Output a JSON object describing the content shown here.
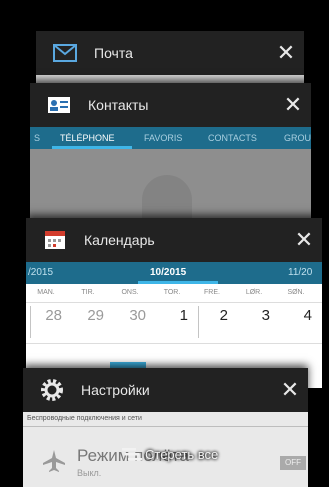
{
  "cards": {
    "mail": {
      "title": "Почта",
      "icon": "mail-icon"
    },
    "contacts": {
      "title": "Контакты",
      "icon": "contacts-card-icon",
      "tabs": [
        "S",
        "TÉLÉPHONE",
        "FAVORIS",
        "CONTACTS",
        "GROU"
      ],
      "active_tab": "TÉLÉPHONE"
    },
    "calendar": {
      "title": "Календарь",
      "icon": "calendar-icon",
      "months": [
        "/2015",
        "10/2015",
        "11/20"
      ],
      "active_month": "10/2015",
      "weekdays": [
        "MAN.",
        "TIR.",
        "ONS.",
        "TOR.",
        "FRE.",
        "LØR.",
        "SØN."
      ],
      "dates": [
        "28",
        "29",
        "30",
        "1",
        "2",
        "3",
        "4"
      ]
    },
    "settings": {
      "title": "Настройки",
      "icon": "gear-icon",
      "section": "Беспроводные подключения и сети",
      "item_label": "Режим полёта",
      "item_sub": "Выкл.",
      "toggle": "OFF"
    }
  },
  "clear_all": {
    "label": "Стереть все",
    "icon": "clear-all-icon"
  },
  "colors": {
    "accent": "#3fb6e8",
    "tab_bar": "#1e6c8c",
    "header": "#222222"
  }
}
